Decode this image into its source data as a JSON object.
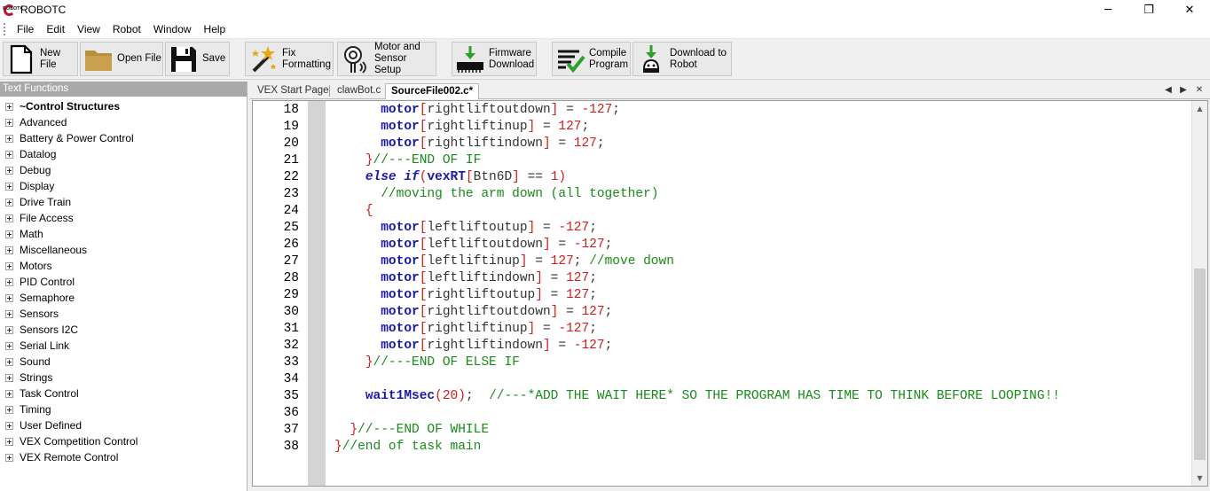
{
  "window": {
    "title": "ROBOTC",
    "icon_text": "ROBOTC",
    "minimize": "─",
    "maximize": "❐",
    "close": "✕"
  },
  "menu": [
    "File",
    "Edit",
    "View",
    "Robot",
    "Window",
    "Help"
  ],
  "toolbar": {
    "new_file": "New File",
    "open_file": "Open File",
    "save": "Save",
    "fix_formatting": "Fix\nFormatting",
    "motor_sensor_setup": "Motor and\nSensor Setup",
    "firmware_download": "Firmware\nDownload",
    "compile_program": "Compile\nProgram",
    "download_to_robot": "Download to\nRobot"
  },
  "left_panel": {
    "title": "Text Functions",
    "items": [
      "~Control Structures",
      "Advanced",
      "Battery & Power Control",
      "Datalog",
      "Debug",
      "Display",
      "Drive Train",
      "File Access",
      "Math",
      "Miscellaneous",
      "Motors",
      "PID Control",
      "Semaphore",
      "Sensors",
      "Sensors I2C",
      "Serial Link",
      "Sound",
      "Strings",
      "Task Control",
      "Timing",
      "User Defined",
      "VEX Competition Control",
      "VEX Remote Control"
    ]
  },
  "tabs": [
    "VEX Start Page",
    "clawBot.c",
    "SourceFile002.c*"
  ],
  "tab_nav": {
    "prev": "◀",
    "next": "▶",
    "close": "✕"
  },
  "scrollbar": {
    "up": "▲",
    "down": "▼",
    "thumb_start": 0.43,
    "thumb_end": 0.97
  },
  "editor": {
    "line_numbers": [
      "18",
      "19",
      "20",
      "21",
      "22",
      "23",
      "24",
      "25",
      "26",
      "27",
      "28",
      "29",
      "30",
      "31",
      "32",
      "33",
      "34",
      "35",
      "36",
      "37",
      "38"
    ],
    "lines": [
      [
        {
          "t": "      ",
          "c": "txt"
        },
        {
          "t": "motor",
          "c": "kw"
        },
        {
          "t": "[",
          "c": "br"
        },
        {
          "t": "rightliftoutdown",
          "c": "txt"
        },
        {
          "t": "]",
          "c": "br"
        },
        {
          "t": " = ",
          "c": "txt"
        },
        {
          "t": "-127",
          "c": "num"
        },
        {
          "t": ";",
          "c": "txt"
        }
      ],
      [
        {
          "t": "      ",
          "c": "txt"
        },
        {
          "t": "motor",
          "c": "kw"
        },
        {
          "t": "[",
          "c": "br"
        },
        {
          "t": "rightliftinup",
          "c": "txt"
        },
        {
          "t": "]",
          "c": "br"
        },
        {
          "t": " = ",
          "c": "txt"
        },
        {
          "t": "127",
          "c": "num"
        },
        {
          "t": ";",
          "c": "txt"
        }
      ],
      [
        {
          "t": "      ",
          "c": "txt"
        },
        {
          "t": "motor",
          "c": "kw"
        },
        {
          "t": "[",
          "c": "br"
        },
        {
          "t": "rightliftindown",
          "c": "txt"
        },
        {
          "t": "]",
          "c": "br"
        },
        {
          "t": " = ",
          "c": "txt"
        },
        {
          "t": "127",
          "c": "num"
        },
        {
          "t": ";",
          "c": "txt"
        }
      ],
      [
        {
          "t": "    ",
          "c": "txt"
        },
        {
          "t": "}",
          "c": "br"
        },
        {
          "t": "//---END OF IF",
          "c": "cm"
        }
      ],
      [
        {
          "t": "    ",
          "c": "txt"
        },
        {
          "t": "else if",
          "c": "kwi"
        },
        {
          "t": "(",
          "c": "br"
        },
        {
          "t": "vexRT",
          "c": "kw"
        },
        {
          "t": "[",
          "c": "br"
        },
        {
          "t": "Btn6D",
          "c": "txt"
        },
        {
          "t": "]",
          "c": "br"
        },
        {
          "t": " == ",
          "c": "txt"
        },
        {
          "t": "1",
          "c": "num"
        },
        {
          "t": ")",
          "c": "br"
        }
      ],
      [
        {
          "t": "      ",
          "c": "txt"
        },
        {
          "t": "//moving the arm down (all together)",
          "c": "cm"
        }
      ],
      [
        {
          "t": "    ",
          "c": "txt"
        },
        {
          "t": "{",
          "c": "br"
        }
      ],
      [
        {
          "t": "      ",
          "c": "txt"
        },
        {
          "t": "motor",
          "c": "kw"
        },
        {
          "t": "[",
          "c": "br"
        },
        {
          "t": "leftliftoutup",
          "c": "txt"
        },
        {
          "t": "]",
          "c": "br"
        },
        {
          "t": " = ",
          "c": "txt"
        },
        {
          "t": "-127",
          "c": "num"
        },
        {
          "t": ";",
          "c": "txt"
        }
      ],
      [
        {
          "t": "      ",
          "c": "txt"
        },
        {
          "t": "motor",
          "c": "kw"
        },
        {
          "t": "[",
          "c": "br"
        },
        {
          "t": "leftliftoutdown",
          "c": "txt"
        },
        {
          "t": "]",
          "c": "br"
        },
        {
          "t": " = ",
          "c": "txt"
        },
        {
          "t": "-127",
          "c": "num"
        },
        {
          "t": ";",
          "c": "txt"
        }
      ],
      [
        {
          "t": "      ",
          "c": "txt"
        },
        {
          "t": "motor",
          "c": "kw"
        },
        {
          "t": "[",
          "c": "br"
        },
        {
          "t": "leftliftinup",
          "c": "txt"
        },
        {
          "t": "]",
          "c": "br"
        },
        {
          "t": " = ",
          "c": "txt"
        },
        {
          "t": "127",
          "c": "num"
        },
        {
          "t": "; ",
          "c": "txt"
        },
        {
          "t": "//move down",
          "c": "cm"
        }
      ],
      [
        {
          "t": "      ",
          "c": "txt"
        },
        {
          "t": "motor",
          "c": "kw"
        },
        {
          "t": "[",
          "c": "br"
        },
        {
          "t": "leftliftindown",
          "c": "txt"
        },
        {
          "t": "]",
          "c": "br"
        },
        {
          "t": " = ",
          "c": "txt"
        },
        {
          "t": "127",
          "c": "num"
        },
        {
          "t": ";",
          "c": "txt"
        }
      ],
      [
        {
          "t": "      ",
          "c": "txt"
        },
        {
          "t": "motor",
          "c": "kw"
        },
        {
          "t": "[",
          "c": "br"
        },
        {
          "t": "rightliftoutup",
          "c": "txt"
        },
        {
          "t": "]",
          "c": "br"
        },
        {
          "t": " = ",
          "c": "txt"
        },
        {
          "t": "127",
          "c": "num"
        },
        {
          "t": ";",
          "c": "txt"
        }
      ],
      [
        {
          "t": "      ",
          "c": "txt"
        },
        {
          "t": "motor",
          "c": "kw"
        },
        {
          "t": "[",
          "c": "br"
        },
        {
          "t": "rightliftoutdown",
          "c": "txt"
        },
        {
          "t": "]",
          "c": "br"
        },
        {
          "t": " = ",
          "c": "txt"
        },
        {
          "t": "127",
          "c": "num"
        },
        {
          "t": ";",
          "c": "txt"
        }
      ],
      [
        {
          "t": "      ",
          "c": "txt"
        },
        {
          "t": "motor",
          "c": "kw"
        },
        {
          "t": "[",
          "c": "br"
        },
        {
          "t": "rightliftinup",
          "c": "txt"
        },
        {
          "t": "]",
          "c": "br"
        },
        {
          "t": " = ",
          "c": "txt"
        },
        {
          "t": "-127",
          "c": "num"
        },
        {
          "t": ";",
          "c": "txt"
        }
      ],
      [
        {
          "t": "      ",
          "c": "txt"
        },
        {
          "t": "motor",
          "c": "kw"
        },
        {
          "t": "[",
          "c": "br"
        },
        {
          "t": "rightliftindown",
          "c": "txt"
        },
        {
          "t": "]",
          "c": "br"
        },
        {
          "t": " = ",
          "c": "txt"
        },
        {
          "t": "-127",
          "c": "num"
        },
        {
          "t": ";",
          "c": "txt"
        }
      ],
      [
        {
          "t": "    ",
          "c": "txt"
        },
        {
          "t": "}",
          "c": "br"
        },
        {
          "t": "//---END OF ELSE IF",
          "c": "cm"
        }
      ],
      [
        {
          "t": "",
          "c": "txt"
        }
      ],
      [
        {
          "t": "    ",
          "c": "txt"
        },
        {
          "t": "wait1Msec",
          "c": "kw"
        },
        {
          "t": "(",
          "c": "br"
        },
        {
          "t": "20",
          "c": "num"
        },
        {
          "t": ")",
          "c": "br"
        },
        {
          "t": ";  ",
          "c": "txt"
        },
        {
          "t": "//---*ADD THE WAIT HERE* SO THE PROGRAM HAS TIME TO THINK BEFORE LOOPING!!",
          "c": "cm"
        }
      ],
      [
        {
          "t": "",
          "c": "txt"
        }
      ],
      [
        {
          "t": "  ",
          "c": "txt"
        },
        {
          "t": "}",
          "c": "br"
        },
        {
          "t": "//---END OF WHILE",
          "c": "cm"
        }
      ],
      [
        {
          "t": "}",
          "c": "br"
        },
        {
          "t": "//end of task main",
          "c": "cm"
        }
      ]
    ]
  }
}
